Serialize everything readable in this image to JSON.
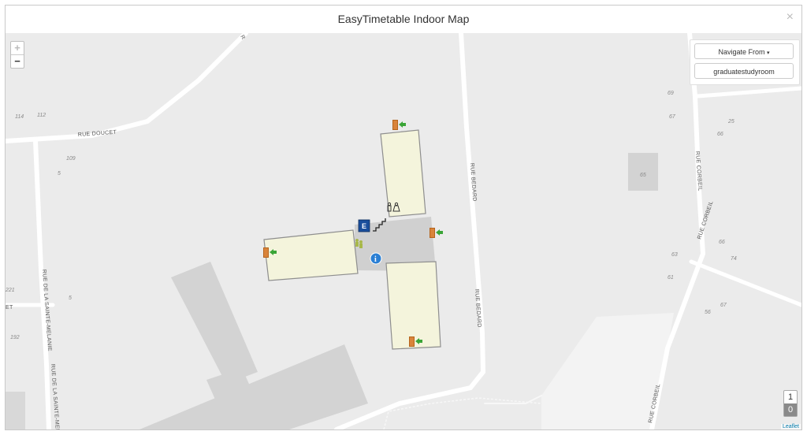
{
  "modal": {
    "title": "EasyTimetable Indoor Map",
    "close_label": "×"
  },
  "zoom": {
    "in_label": "+",
    "out_label": "−"
  },
  "panel": {
    "navigate_label": "Navigate From",
    "room_label": "graduatestudyroom"
  },
  "levels": [
    "1",
    "0"
  ],
  "active_level": "0",
  "attribution": "Leaflet",
  "streets": {
    "doucet": "RUE DOUCET",
    "bedard_top": "RUE BEDARD",
    "bedard_bottom": "RUE BEDARD",
    "corbeil_top": "RUE CORBEIL",
    "corbeil_mid": "RUE CORBEIL",
    "corbeil_bottom": "RUE CORBEIL",
    "sainte_melanie_1": "RUE DE LA SAINTE-MELANIE",
    "sainte_melanie_2": "RUE DE LA SAINTE-MELA",
    "partial_left": "ET",
    "partial_top": "R"
  },
  "house_numbers": [
    "114",
    "112",
    "109",
    "5",
    "221",
    "5",
    "192",
    "69",
    "67",
    "25",
    "66",
    "65",
    "66",
    "63",
    "74",
    "61",
    "67",
    "56"
  ],
  "icons": {
    "elevator_letter": "E",
    "info_letter": "i"
  }
}
